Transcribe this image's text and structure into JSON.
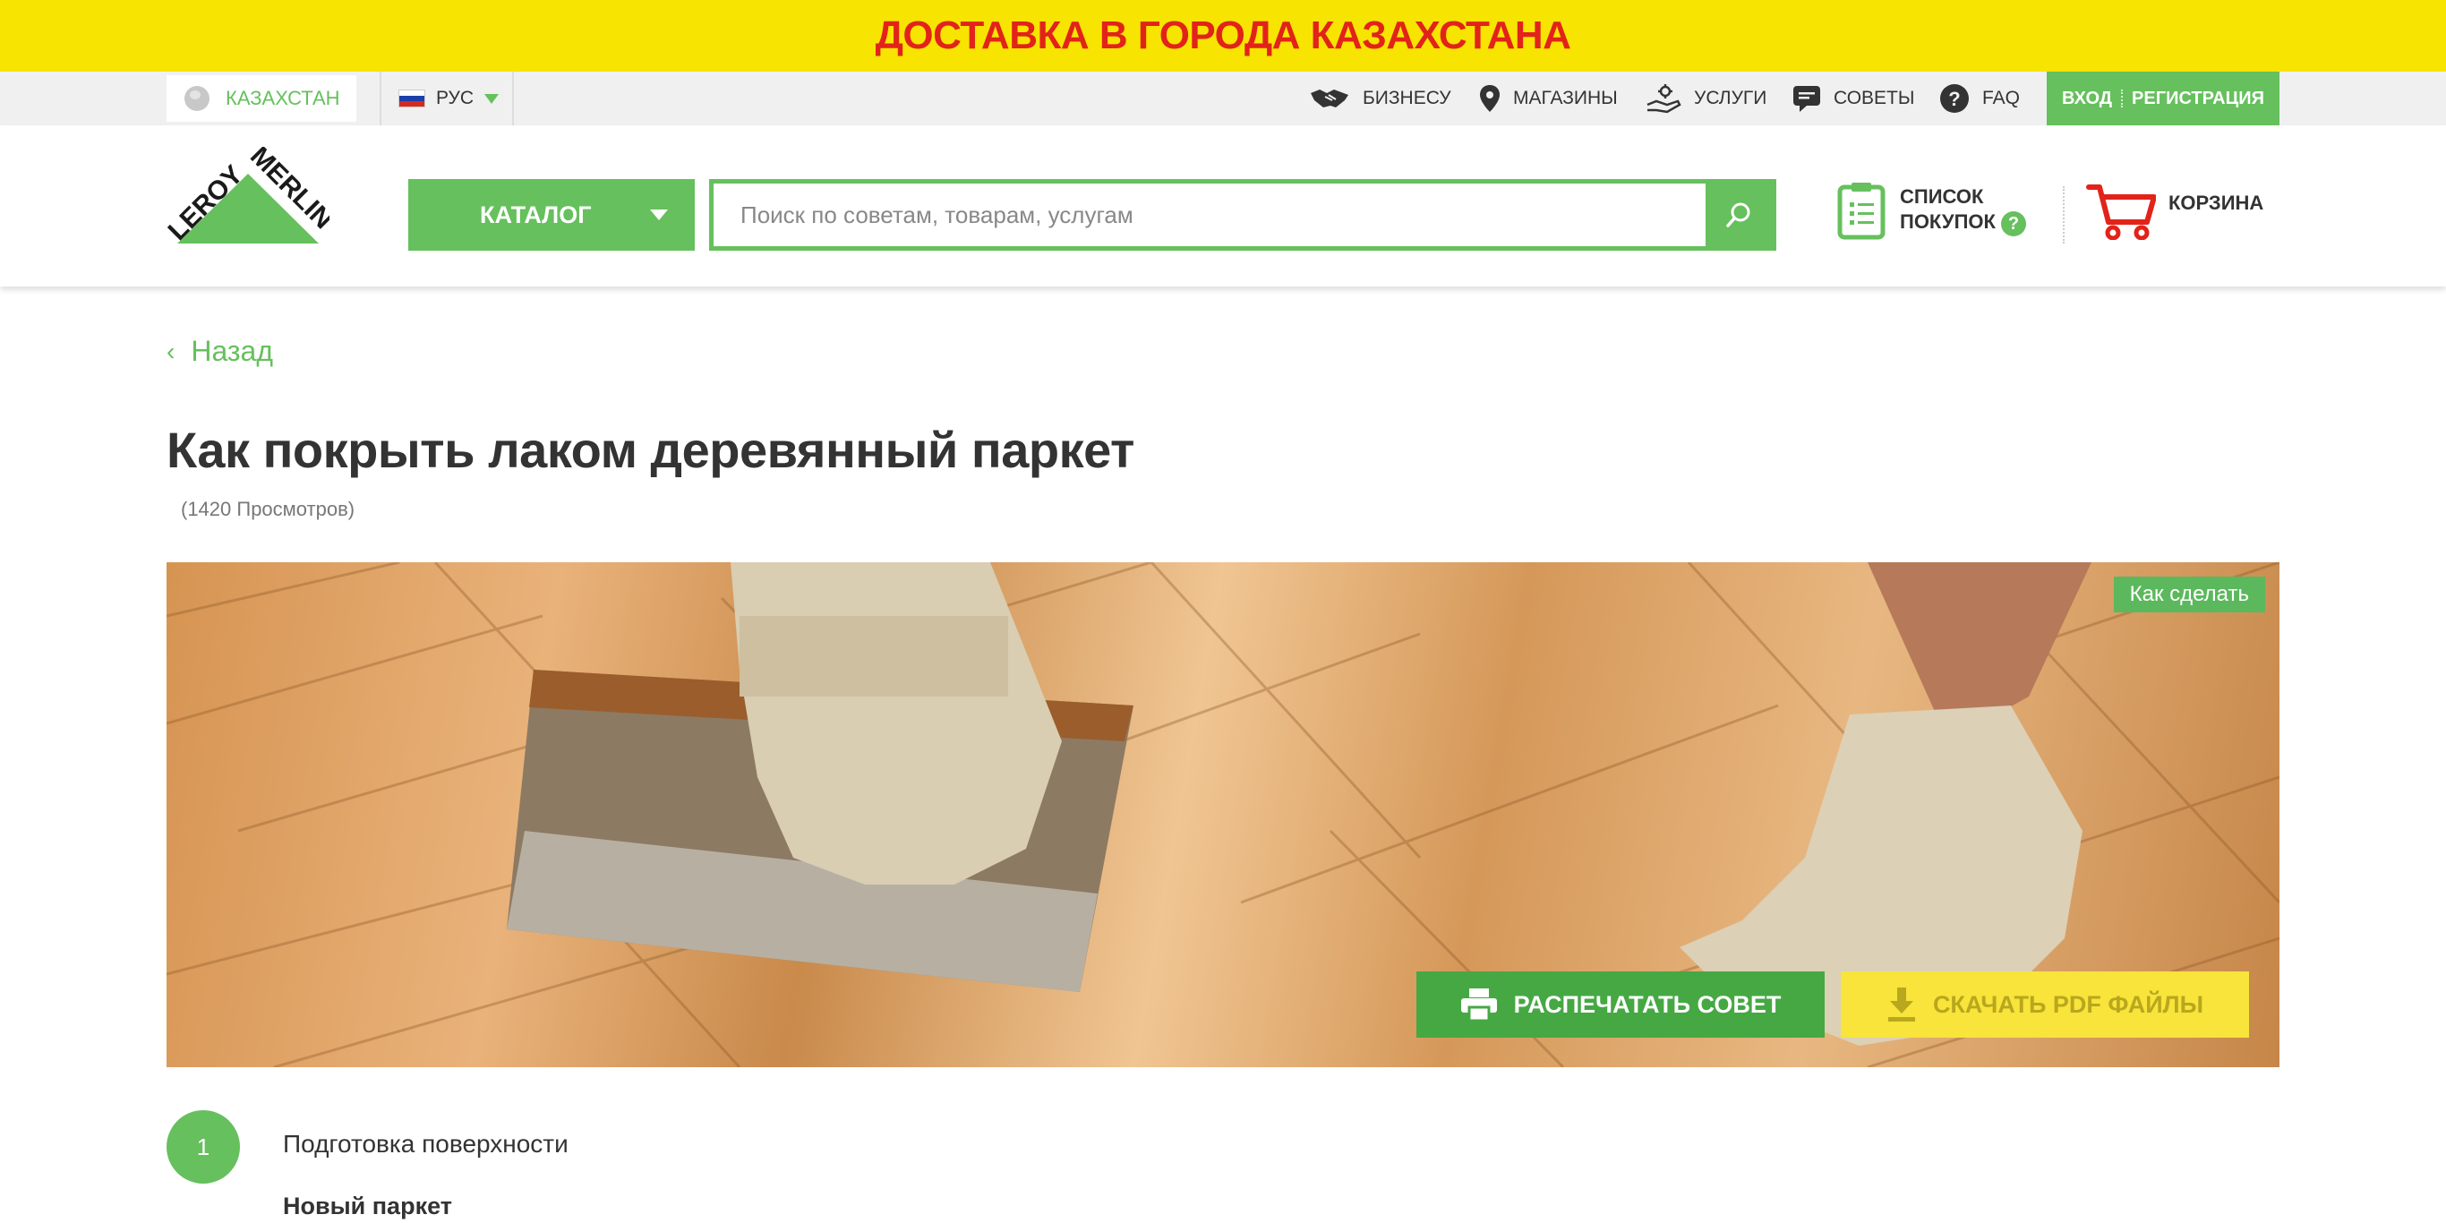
{
  "promo": {
    "text": "ДОСТАВКА В ГОРОДА КАЗАХСТАНА"
  },
  "topbar": {
    "region": "КАЗАХСТАН",
    "language": "РУС",
    "nav": [
      {
        "label": "БИЗНЕСУ",
        "icon": "handshake-icon"
      },
      {
        "label": "МАГАЗИНЫ",
        "icon": "map-pin-icon"
      },
      {
        "label": "УСЛУГИ",
        "icon": "services-hand-icon"
      },
      {
        "label": "СОВЕТЫ",
        "icon": "chat-bubble-icon"
      },
      {
        "label": "FAQ",
        "icon": "question-circle-icon"
      }
    ],
    "login": "ВХОД",
    "register": "РЕГИСТРАЦИЯ"
  },
  "header": {
    "logo_text": "LEROY MERLIN",
    "catalog": "КАТАЛОГ",
    "search_placeholder": "Поиск по советам, товарам, услугам",
    "shopping_list_line1": "СПИСОК",
    "shopping_list_line2": "ПОКУПОК",
    "help_mark": "?",
    "cart": "КОРЗИНА"
  },
  "article": {
    "back": "Назад",
    "title": "Как покрыть лаком деревянный паркет",
    "views": "(1420 Просмотров)",
    "tag": "Как сделать",
    "print_button": "РАСПЕЧАТАТЬ СОВЕТ",
    "pdf_button": "СКАЧАТЬ PDF ФАЙЛЫ",
    "step_number": "1",
    "step_title": "Подготовка поверхности",
    "subheading": "Новый паркет"
  },
  "colors": {
    "brand_green": "#66c05d",
    "promo_yellow": "#f7e400",
    "promo_red": "#e2231a",
    "pdf_yellow": "#f8e43a",
    "cart_red": "#e2231a"
  }
}
